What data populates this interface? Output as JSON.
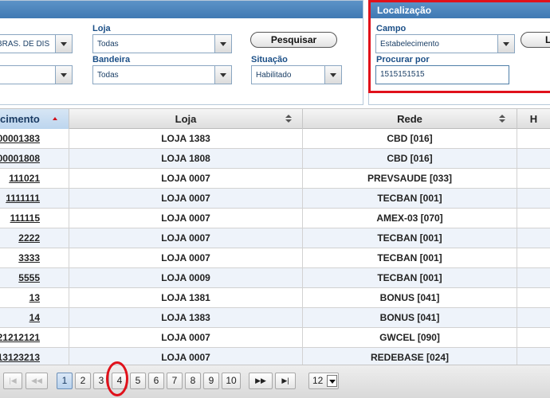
{
  "filters": {
    "first_select_value": "BRAS. DE DIS",
    "second_select_value": "",
    "loja_label": "Loja",
    "loja_value": "Todas",
    "bandeira_label": "Bandeira",
    "bandeira_value": "Todas",
    "search_button": "Pesquisar",
    "situacao_label": "Situação",
    "situacao_value": "Habilitado"
  },
  "localizacao": {
    "title": "Localização",
    "campo_label": "Campo",
    "campo_value": "Estabelecimento",
    "procurar_label": "Procurar por",
    "procurar_value": "1515151515",
    "button_partial": "L"
  },
  "table": {
    "headers": [
      "cimento",
      "Loja",
      "Rede",
      "H"
    ],
    "rows": [
      {
        "estab": "00001383",
        "loja": "LOJA 1383",
        "rede": "CBD [016]"
      },
      {
        "estab": "00001808",
        "loja": "LOJA 1808",
        "rede": "CBD [016]"
      },
      {
        "estab": "111021",
        "loja": "LOJA 0007",
        "rede": "PREVSAUDE [033]"
      },
      {
        "estab": "1111111",
        "loja": "LOJA 0007",
        "rede": "TECBAN [001]"
      },
      {
        "estab": "111115",
        "loja": "LOJA 0007",
        "rede": "AMEX-03 [070]"
      },
      {
        "estab": "2222",
        "loja": "LOJA 0007",
        "rede": "TECBAN [001]"
      },
      {
        "estab": "3333",
        "loja": "LOJA 0007",
        "rede": "TECBAN [001]"
      },
      {
        "estab": "5555",
        "loja": "LOJA 0009",
        "rede": "TECBAN [001]"
      },
      {
        "estab": "13",
        "loja": "LOJA 1381",
        "rede": "BONUS [041]"
      },
      {
        "estab": "14",
        "loja": "LOJA 1383",
        "rede": "BONUS [041]"
      },
      {
        "estab": "21212121",
        "loja": "LOJA 0007",
        "rede": "GWCEL [090]"
      },
      {
        "estab": "13123213",
        "loja": "LOJA 0007",
        "rede": "REDEBASE [024]"
      }
    ]
  },
  "pager": {
    "first": "|◀",
    "prev": "◀◀",
    "pages": [
      "1",
      "2",
      "3",
      "4",
      "5",
      "6",
      "7",
      "8",
      "9",
      "10"
    ],
    "current_page": "1",
    "next": "▶▶",
    "last": "▶|",
    "page_size": "12"
  },
  "colors": {
    "header_blue": "#3f79b3",
    "label_blue": "#1b4f87",
    "highlight_red": "#e0111b",
    "row_alt": "#eef3fa"
  }
}
